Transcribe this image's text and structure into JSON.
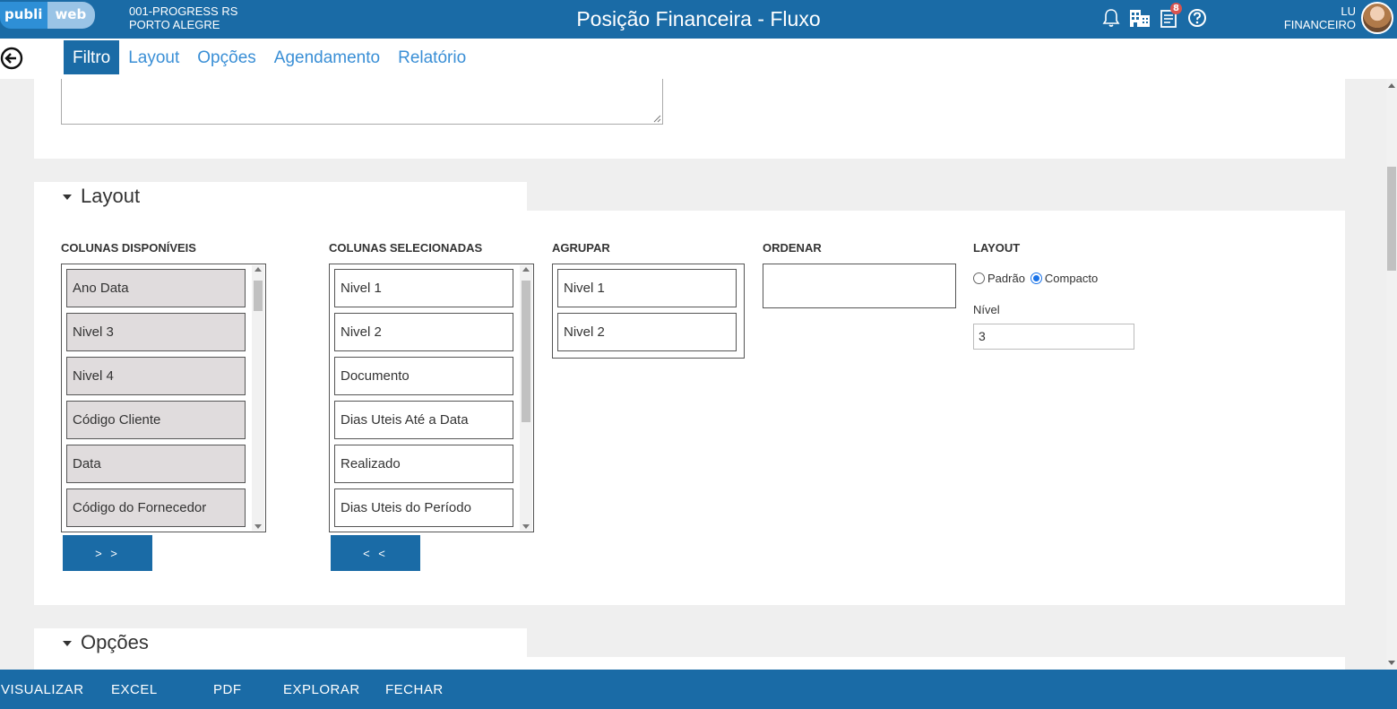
{
  "header": {
    "logo_part1": "publi",
    "logo_part2": "web",
    "company_line1": "001-PROGRESS RS",
    "company_line2": "PORTO ALEGRE",
    "title": "Posição Financeira - Fluxo",
    "notifications_badge": "8",
    "user_line1": "LU",
    "user_line2": "FINANCEIRO"
  },
  "tabs": [
    {
      "label": "Filtro",
      "active": true
    },
    {
      "label": "Layout",
      "active": false
    },
    {
      "label": "Opções",
      "active": false
    },
    {
      "label": "Agendamento",
      "active": false
    },
    {
      "label": "Relatório",
      "active": false
    }
  ],
  "layout_section": {
    "title": "Layout",
    "available_label": "COLUNAS DISPONÍVEIS",
    "available_items": [
      "Ano Data",
      "Nivel 3",
      "Nivel 4",
      "Código Cliente",
      "Data",
      "Código do Fornecedor"
    ],
    "selected_label": "COLUNAS SELECIONADAS",
    "selected_items": [
      "Nivel 1",
      "Nivel 2",
      "Documento",
      "Dias Uteis Até a Data",
      "Realizado",
      "Dias Uteis do Período"
    ],
    "group_label": "AGRUPAR",
    "group_items": [
      "Nivel 1",
      "Nivel 2"
    ],
    "order_label": "ORDENAR",
    "layout_label": "LAYOUT",
    "radio_padrao": "Padrão",
    "radio_compacto": "Compacto",
    "nivel_label": "Nível",
    "nivel_value": "3",
    "add_button": "> >",
    "remove_button": "< <"
  },
  "options_section": {
    "title": "Opções"
  },
  "footer": {
    "visualizar": "VISUALIZAR",
    "excel": "EXCEL",
    "pdf": "PDF",
    "explorar": "EXPLORAR",
    "fechar": "FECHAR"
  },
  "colors": {
    "primary": "#1a6ba6",
    "tab_link": "#3a8fd6",
    "list_grey": "#e0dcdd"
  }
}
